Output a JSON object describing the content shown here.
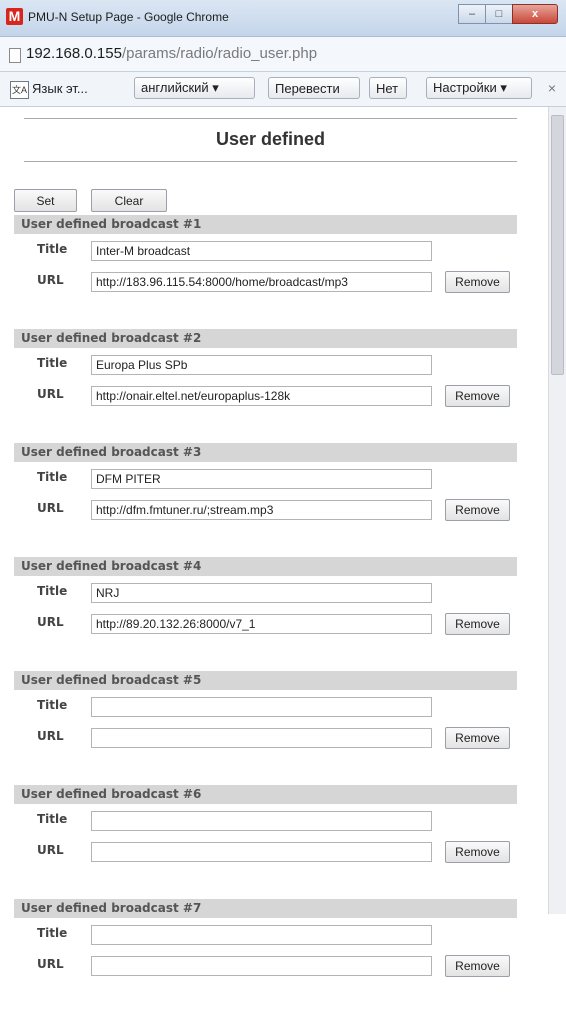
{
  "window": {
    "title": "PMU-N Setup Page - Google Chrome",
    "app_icon_letter": "M",
    "minimize": "–",
    "maximize": "□",
    "close": "x"
  },
  "address": {
    "host": "192.168.0.155",
    "path": "/params/radio/radio_user.php"
  },
  "translate_bar": {
    "icon": "translate-icon",
    "label": "Язык эт...",
    "language": "английский ▾",
    "translate": "Перевести",
    "no": "Нет",
    "settings": "Настройки ▾",
    "close": "×"
  },
  "page": {
    "title": "User defined"
  },
  "actions": {
    "set": "Set",
    "clear": "Clear"
  },
  "labels": {
    "title": "Title",
    "url": "URL",
    "remove": "Remove"
  },
  "broadcasts": [
    {
      "header": "User defined broadcast #1",
      "title": "Inter-M broadcast",
      "url": "http://183.96.115.54:8000/home/broadcast/mp3"
    },
    {
      "header": "User defined broadcast #2",
      "title": "Europa Plus SPb",
      "url": "http://onair.eltel.net/europaplus-128k"
    },
    {
      "header": "User defined broadcast #3",
      "title": "DFM PITER",
      "url": "http://dfm.fmtuner.ru/;stream.mp3"
    },
    {
      "header": "User defined broadcast #4",
      "title": "NRJ",
      "url": "http://89.20.132.26:8000/v7_1"
    },
    {
      "header": "User defined broadcast #5",
      "title": "",
      "url": ""
    },
    {
      "header": "User defined broadcast #6",
      "title": "",
      "url": ""
    },
    {
      "header": "User defined broadcast #7",
      "title": "",
      "url": ""
    }
  ]
}
